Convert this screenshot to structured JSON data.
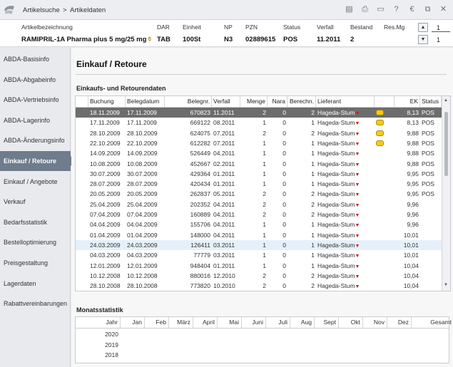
{
  "breadcrumb": {
    "section": "Artikelsuche",
    "separator": ">",
    "current": "Artikeldaten"
  },
  "toolbar_icons": [
    "clipboard-icon",
    "print-icon",
    "monitor-icon",
    "help-icon",
    "euro-icon",
    "export-icon",
    "close-icon"
  ],
  "article_header": {
    "labels": {
      "name": "Artikelbezeichnung",
      "dar": "DAR",
      "einheit": "Einheit",
      "np": "NP",
      "pzn": "PZN",
      "status": "Status",
      "verfall": "Verfall",
      "bestand": "Bestand",
      "resmg": "Res.Mg"
    },
    "values": {
      "name": "RAMIPRIL-1A Pharma plus 5 mg/25 mg",
      "dar": "TAB",
      "einheit": "100St",
      "np": "N3",
      "pzn": "02889615",
      "status": "POS",
      "verfall": "11.2011",
      "bestand": "2"
    },
    "pager": {
      "top": "1",
      "bottom": "1"
    }
  },
  "sidebar": {
    "items": [
      {
        "label": "ABDA-Basisinfo",
        "active": false
      },
      {
        "label": "ABDA-Abgabeinfo",
        "active": false
      },
      {
        "label": "ABDA-Vertriebsinfo",
        "active": false
      },
      {
        "label": "ABDA-Lagerinfo",
        "active": false
      },
      {
        "label": "ABDA-Änderungsinfo",
        "active": false
      },
      {
        "label": "Einkauf / Retoure",
        "active": true
      },
      {
        "label": "Einkauf / Angebote",
        "active": false
      },
      {
        "label": "Verkauf",
        "active": false
      },
      {
        "label": "Bedarfsstatistik",
        "active": false
      },
      {
        "label": "Bestelloptimierung",
        "active": false
      },
      {
        "label": "Preisgestaltung",
        "active": false
      },
      {
        "label": "Lagerdaten",
        "active": false
      },
      {
        "label": "Rabattvereinbarungen",
        "active": false
      }
    ]
  },
  "main": {
    "title": "Einkauf / Retoure",
    "table_section": "Einkaufs- und Retourendaten",
    "columns": [
      "Buchung",
      "Belegdatum",
      "Belegnr.",
      "Verfall",
      "Menge",
      "Nara",
      "Berechn.",
      "Lieferant",
      "",
      "EK",
      "Status"
    ],
    "rows": [
      {
        "buchung": "18.11.2009",
        "beleg": "17.11.2009",
        "nr": "670823",
        "verfall": "11.2011",
        "menge": "2",
        "nara": "0",
        "berechn": "2",
        "lieferant": "Hageda-Stum",
        "offer": true,
        "ek": "8,13",
        "status": "POS",
        "selected": true
      },
      {
        "buchung": "17.11.2009",
        "beleg": "17.11.2009",
        "nr": "669122",
        "verfall": "08.2011",
        "menge": "1",
        "nara": "0",
        "berechn": "1",
        "lieferant": "Hageda-Stum",
        "offer": true,
        "ek": "8,13",
        "status": "POS"
      },
      {
        "buchung": "28.10.2009",
        "beleg": "28.10.2009",
        "nr": "624075",
        "verfall": "07.2011",
        "menge": "2",
        "nara": "0",
        "berechn": "2",
        "lieferant": "Hageda-Stum",
        "offer": true,
        "ek": "9,88",
        "status": "POS"
      },
      {
        "buchung": "22.10.2009",
        "beleg": "22.10.2009",
        "nr": "612282",
        "verfall": "07.2011",
        "menge": "1",
        "nara": "0",
        "berechn": "1",
        "lieferant": "Hageda-Stum",
        "offer": true,
        "ek": "9,88",
        "status": "POS"
      },
      {
        "buchung": "14.09.2009",
        "beleg": "14.09.2009",
        "nr": "526449",
        "verfall": "04.2011",
        "menge": "1",
        "nara": "0",
        "berechn": "1",
        "lieferant": "Hageda-Stum",
        "offer": false,
        "ek": "9,88",
        "status": "POS"
      },
      {
        "buchung": "10.08.2009",
        "beleg": "10.08.2009",
        "nr": "452667",
        "verfall": "02.2011",
        "menge": "1",
        "nara": "0",
        "berechn": "1",
        "lieferant": "Hageda-Stum",
        "offer": false,
        "ek": "9,88",
        "status": "POS"
      },
      {
        "buchung": "30.07.2009",
        "beleg": "30.07.2009",
        "nr": "429364",
        "verfall": "01.2011",
        "menge": "1",
        "nara": "0",
        "berechn": "1",
        "lieferant": "Hageda-Stum",
        "offer": false,
        "ek": "9,95",
        "status": "POS"
      },
      {
        "buchung": "28.07.2009",
        "beleg": "28.07.2009",
        "nr": "420434",
        "verfall": "01.2011",
        "menge": "1",
        "nara": "0",
        "berechn": "1",
        "lieferant": "Hageda-Stum",
        "offer": false,
        "ek": "9,95",
        "status": "POS"
      },
      {
        "buchung": "20.05.2009",
        "beleg": "20.05.2009",
        "nr": "262837",
        "verfall": "05.2011",
        "menge": "2",
        "nara": "0",
        "berechn": "2",
        "lieferant": "Hageda-Stum",
        "offer": false,
        "ek": "9,95",
        "status": "POS"
      },
      {
        "buchung": "25.04.2009",
        "beleg": "25.04.2009",
        "nr": "202352",
        "verfall": "04.2011",
        "menge": "2",
        "nara": "0",
        "berechn": "2",
        "lieferant": "Hageda-Stum",
        "offer": false,
        "ek": "9,96",
        "status": ""
      },
      {
        "buchung": "07.04.2009",
        "beleg": "07.04.2009",
        "nr": "160889",
        "verfall": "04.2011",
        "menge": "2",
        "nara": "0",
        "berechn": "2",
        "lieferant": "Hageda-Stum",
        "offer": false,
        "ek": "9,96",
        "status": ""
      },
      {
        "buchung": "04.04.2009",
        "beleg": "04.04.2009",
        "nr": "155706",
        "verfall": "04.2011",
        "menge": "1",
        "nara": "0",
        "berechn": "1",
        "lieferant": "Hageda-Stum",
        "offer": false,
        "ek": "9,96",
        "status": ""
      },
      {
        "buchung": "01.04.2009",
        "beleg": "01.04.2009",
        "nr": "148000",
        "verfall": "04.2011",
        "menge": "1",
        "nara": "0",
        "berechn": "1",
        "lieferant": "Hageda-Stum",
        "offer": false,
        "ek": "10,01",
        "status": ""
      },
      {
        "buchung": "24.03.2009",
        "beleg": "24.03.2009",
        "nr": "126411",
        "verfall": "03.2011",
        "menge": "1",
        "nara": "0",
        "berechn": "1",
        "lieferant": "Hageda-Stum",
        "offer": false,
        "ek": "10,01",
        "status": "",
        "hover": true
      },
      {
        "buchung": "04.03.2009",
        "beleg": "04.03.2009",
        "nr": "77779",
        "verfall": "03.2011",
        "menge": "1",
        "nara": "0",
        "berechn": "1",
        "lieferant": "Hageda-Stum",
        "offer": false,
        "ek": "10,01",
        "status": ""
      },
      {
        "buchung": "12.01.2009",
        "beleg": "12.01.2009",
        "nr": "948404",
        "verfall": "01.2011",
        "menge": "1",
        "nara": "0",
        "berechn": "1",
        "lieferant": "Hageda-Stum",
        "offer": false,
        "ek": "10,04",
        "status": ""
      },
      {
        "buchung": "10.12.2008",
        "beleg": "10.12.2008",
        "nr": "880016",
        "verfall": "12.2010",
        "menge": "2",
        "nara": "0",
        "berechn": "2",
        "lieferant": "Hageda-Stum",
        "offer": false,
        "ek": "10,04",
        "status": ""
      },
      {
        "buchung": "28.10.2008",
        "beleg": "28.10.2008",
        "nr": "773820",
        "verfall": "10.2010",
        "menge": "2",
        "nara": "0",
        "berechn": "2",
        "lieferant": "Hageda-Stum",
        "offer": false,
        "ek": "10,04",
        "status": ""
      }
    ],
    "monthly_section": "Monatsstatistik",
    "monthly_columns": [
      "Jahr",
      "Jan",
      "Feb",
      "März",
      "April",
      "Mai",
      "Juni",
      "Juli",
      "Aug",
      "Sept",
      "Okt",
      "Nov",
      "Dez",
      "Gesamt"
    ],
    "monthly_years": [
      "2020",
      "2019",
      "2018"
    ]
  },
  "colors": {
    "active_nav": "#6f7c8b",
    "selected_row": "#6d6d6d",
    "flag": "#cc1b1b",
    "coin": "#f1cc1a"
  }
}
